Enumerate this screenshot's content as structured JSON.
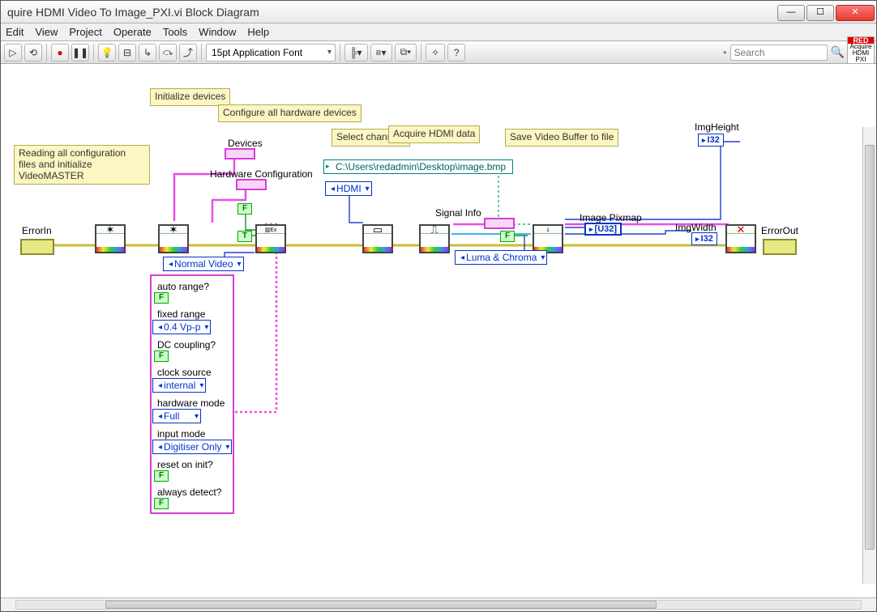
{
  "window": {
    "title": "quire HDMI Video To Image_PXI.vi Block Diagram"
  },
  "menu": [
    "Edit",
    "View",
    "Project",
    "Operate",
    "Tools",
    "Window",
    "Help"
  ],
  "toolbar": {
    "font": "15pt Application Font",
    "search_placeholder": "Search"
  },
  "product_icon": {
    "top": "RED",
    "mid": "Acquire",
    "bot": "HDMI PXI"
  },
  "comments": {
    "read_config": "Reading all configuration files\nand initialize VideoMASTER",
    "init_dev": "Initialize\ndevices",
    "config_hw": "Configure all\nhardware devices",
    "select_ch": "Select\nchannels",
    "acq_hdmi": "Acquire\nHDMI data",
    "save_buf": "Save Video\nBuffer to file"
  },
  "labels": {
    "devices": "Devices",
    "hw_config": "Hardware Configuration",
    "error_in": "ErrorIn",
    "error_out": "ErrorOut",
    "signal_info": "Signal Info",
    "image_pixmap": "Image Pixmap",
    "img_width": "ImgWidth",
    "img_height": "ImgHeight",
    "normal_video": "Normal Video",
    "hdmi": "HDMI",
    "luma_chroma": "Luma & Chroma",
    "path_const": "C:\\Users\\redadmin\\Desktop\\image.bmp",
    "i32": "I32",
    "u32arr": "[U32]"
  },
  "cluster": {
    "items": [
      {
        "label": "auto range?",
        "ctrl": "F"
      },
      {
        "label": "fixed range",
        "ctrl": "ring",
        "value": "0.4 Vp-p"
      },
      {
        "label": "DC coupling?",
        "ctrl": "F"
      },
      {
        "label": "clock source",
        "ctrl": "ring",
        "value": "internal"
      },
      {
        "label": "hardware mode",
        "ctrl": "ring",
        "value": "Full"
      },
      {
        "label": "input mode",
        "ctrl": "ring",
        "value": "Digitiser Only"
      },
      {
        "label": "reset on init?",
        "ctrl": "F"
      },
      {
        "label": "always detect?",
        "ctrl": "F"
      }
    ]
  }
}
